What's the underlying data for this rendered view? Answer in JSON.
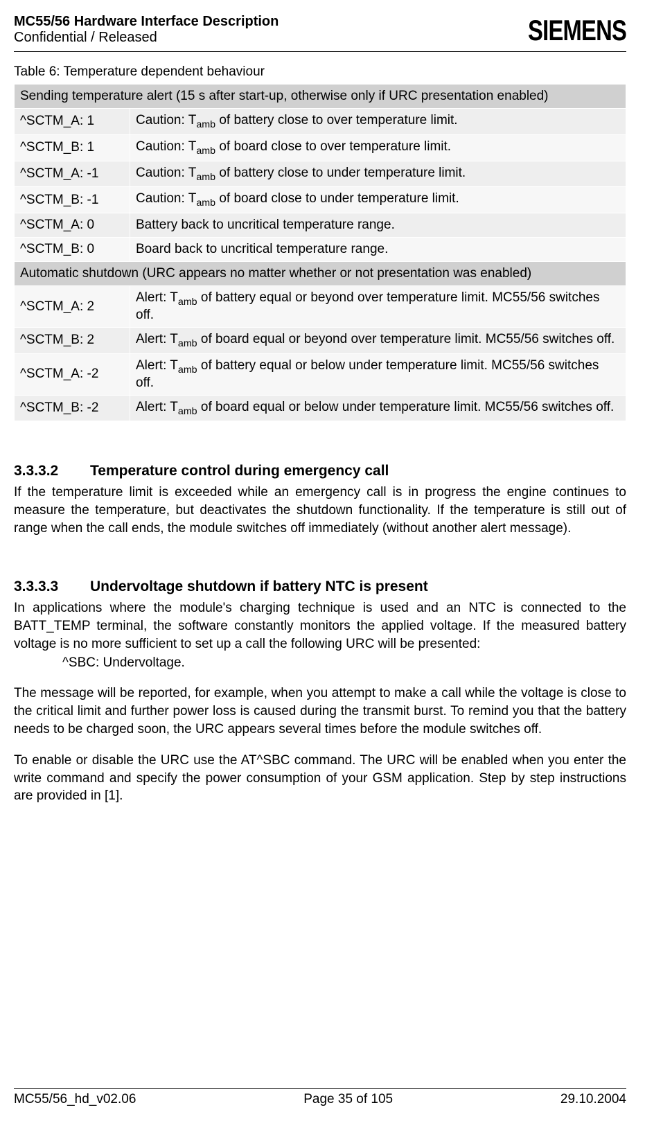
{
  "header": {
    "title": "MC55/56 Hardware Interface Description",
    "status": "Confidential / Released",
    "logo": "SIEMENS"
  },
  "table": {
    "caption": "Table 6: Temperature dependent behaviour",
    "section1_header": "Sending temperature alert (15 s after start-up, otherwise only if URC presentation enabled)",
    "rows1": [
      {
        "code": "^SCTM_A:  1",
        "desc_pre": "Caution: T",
        "desc_sub": "amb",
        "desc_post": " of battery close to over temperature limit."
      },
      {
        "code": "^SCTM_B:  1",
        "desc_pre": "Caution: T",
        "desc_sub": "amb",
        "desc_post": " of board close to over temperature limit."
      },
      {
        "code": "^SCTM_A:  -1",
        "desc_pre": "Caution: T",
        "desc_sub": "amb",
        "desc_post": " of battery close to under temperature limit."
      },
      {
        "code": "^SCTM_B:  -1",
        "desc_pre": "Caution: T",
        "desc_sub": "amb",
        "desc_post": " of board close to under temperature limit."
      },
      {
        "code": "^SCTM_A: 0",
        "desc_pre": "Battery back to uncritical temperature range.",
        "desc_sub": "",
        "desc_post": ""
      },
      {
        "code": "^SCTM_B: 0",
        "desc_pre": "Board back to uncritical temperature range.",
        "desc_sub": "",
        "desc_post": ""
      }
    ],
    "section2_header": "Automatic shutdown (URC appears no matter whether or not presentation was enabled)",
    "rows2": [
      {
        "code": "^SCTM_A:  2",
        "desc_pre": "Alert: T",
        "desc_sub": "amb",
        "desc_post": " of battery equal or beyond over temperature limit. MC55/56 switches off."
      },
      {
        "code": "^SCTM_B:  2",
        "desc_pre": "Alert: T",
        "desc_sub": "amb",
        "desc_post": " of board equal or beyond over temperature limit. MC55/56 switches off."
      },
      {
        "code": "^SCTM_A:  -2",
        "desc_pre": "Alert: T",
        "desc_sub": "amb",
        "desc_post": " of battery equal or below under temperature limit. MC55/56 switches off."
      },
      {
        "code": "^SCTM_B:  -2",
        "desc_pre": "Alert: T",
        "desc_sub": "amb",
        "desc_post": " of board equal or below under temperature limit. MC55/56 switches off."
      }
    ]
  },
  "sec1": {
    "num": "3.3.3.2",
    "title": "Temperature control during emergency call",
    "body": "If the temperature limit is exceeded while an emergency call is in progress the engine continues to measure the temperature, but deactivates the shutdown functionality. If the temperature is still out of range when the call ends, the module switches off immediately (without another alert message)."
  },
  "sec2": {
    "num": "3.3.3.3",
    "title": "Undervoltage shutdown if battery NTC is present",
    "body1": "In applications where the module's charging technique is used and an NTC is connected to the BATT_TEMP terminal, the software constantly monitors the applied voltage. If the measured battery voltage is no more sufficient to set up a call the following URC will be presented:",
    "urc": "^SBC:  Undervoltage.",
    "body2": "The message will be reported, for example, when you attempt to make a call while the voltage is close to the critical limit and further power loss is caused during the transmit burst. To remind you that the battery needs to be charged soon, the URC appears several times before the module switches off.",
    "body3": "To enable or disable the URC use the AT^SBC command. The URC will be enabled when you enter the write command and specify the power consumption of your GSM application. Step by step instructions are provided in [1]."
  },
  "footer": {
    "doc_id": "MC55/56_hd_v02.06",
    "page": "Page 35 of 105",
    "date": "29.10.2004"
  }
}
